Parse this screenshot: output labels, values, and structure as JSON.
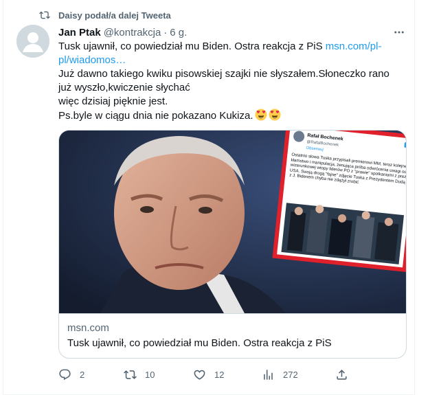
{
  "retweet": {
    "text": "Daisy podał/a dalej Tweeta",
    "icon": "retweet-icon"
  },
  "author": {
    "name": "Jan Ptak",
    "handle": "@kontrakcja",
    "separator": "·",
    "time": "6 g."
  },
  "tweet": {
    "line1_text": "Tusk ujawnił, co powiedział mu Biden. Ostra reakcja z PiS ",
    "link_text": "msn.com/pl-pl/wiadomos…",
    "line2": "Już dawno takiego kwiku pisowskiej szajki nie słyszałem.Słoneczko rano już wyszło,kwiczenie słychać",
    "line3": "więc dzisiaj pięknie jest.",
    "line4": "Ps.byle w ciągu dnia nie pokazano Kukiza.",
    "emoji": "heart-eyes-emoji"
  },
  "card": {
    "domain": "msn.com",
    "title": "Tusk ujawnił, co powiedział mu Biden. Ostra reakcja z PiS",
    "inset": {
      "author_name": "Rafał Bochenek",
      "author_handle": "@RafalBochenek",
      "follow_label": "Obserwuj",
      "text": "Ostatnio słowa Tuska przypisali premierowi MM, teraz kolejne kłamstwo i manipulacja, żenująca próba odwrócenia uwagi od wizerunkowej wtopy liderów PO z \"prawie\" spotkaniami z prez. USA. Swoją drogą \"fajne\" zdjęcie Tuska z Prezydentem Dudą z J. Bidenem chyba nie zdążył zrobić"
    }
  },
  "actions": {
    "reply": "2",
    "retweet": "10",
    "like": "12",
    "views": "272"
  },
  "colors": {
    "accent": "#1d9bf0",
    "secondary_text": "#536471",
    "border": "#cfd9de"
  }
}
